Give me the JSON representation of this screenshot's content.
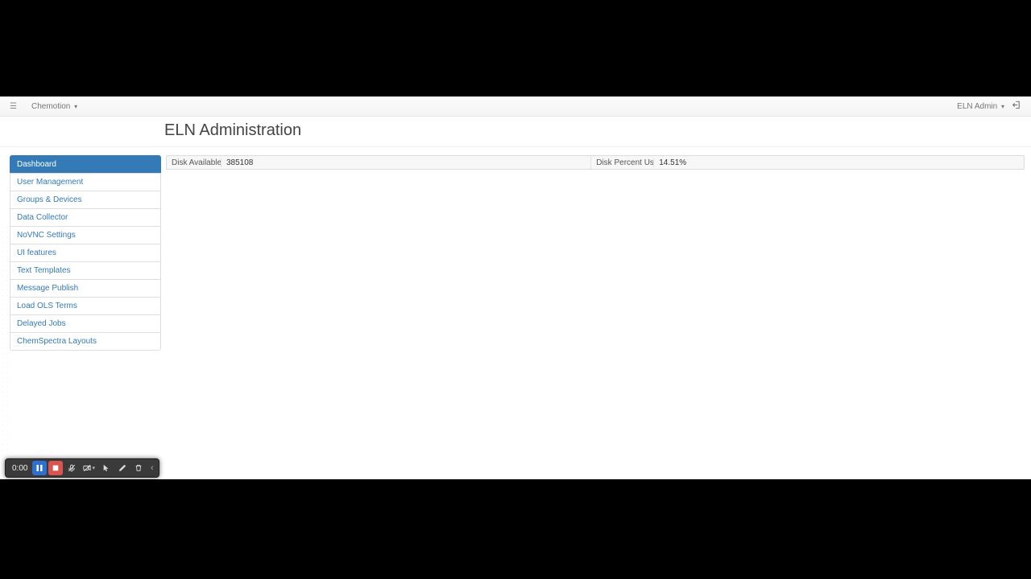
{
  "navbar": {
    "brand": "Chemotion",
    "user": "ELN Admin"
  },
  "page": {
    "title": "ELN Administration"
  },
  "sidebar": {
    "items": [
      {
        "label": "Dashboard",
        "active": true
      },
      {
        "label": "User Management",
        "active": false
      },
      {
        "label": "Groups & Devices",
        "active": false
      },
      {
        "label": "Data Collector",
        "active": false
      },
      {
        "label": "NoVNC Settings",
        "active": false
      },
      {
        "label": "UI features",
        "active": false
      },
      {
        "label": "Text Templates",
        "active": false
      },
      {
        "label": "Message Publish",
        "active": false
      },
      {
        "label": "Load OLS Terms",
        "active": false
      },
      {
        "label": "Delayed Jobs",
        "active": false
      },
      {
        "label": "ChemSpectra Layouts",
        "active": false
      }
    ]
  },
  "dashboard": {
    "disk_available_label": "Disk Available (MB)",
    "disk_available_value": "385108",
    "disk_percent_label": "Disk Percent Used (%)",
    "disk_percent_value": "14.51%"
  },
  "toolbar": {
    "time": "0:00"
  }
}
